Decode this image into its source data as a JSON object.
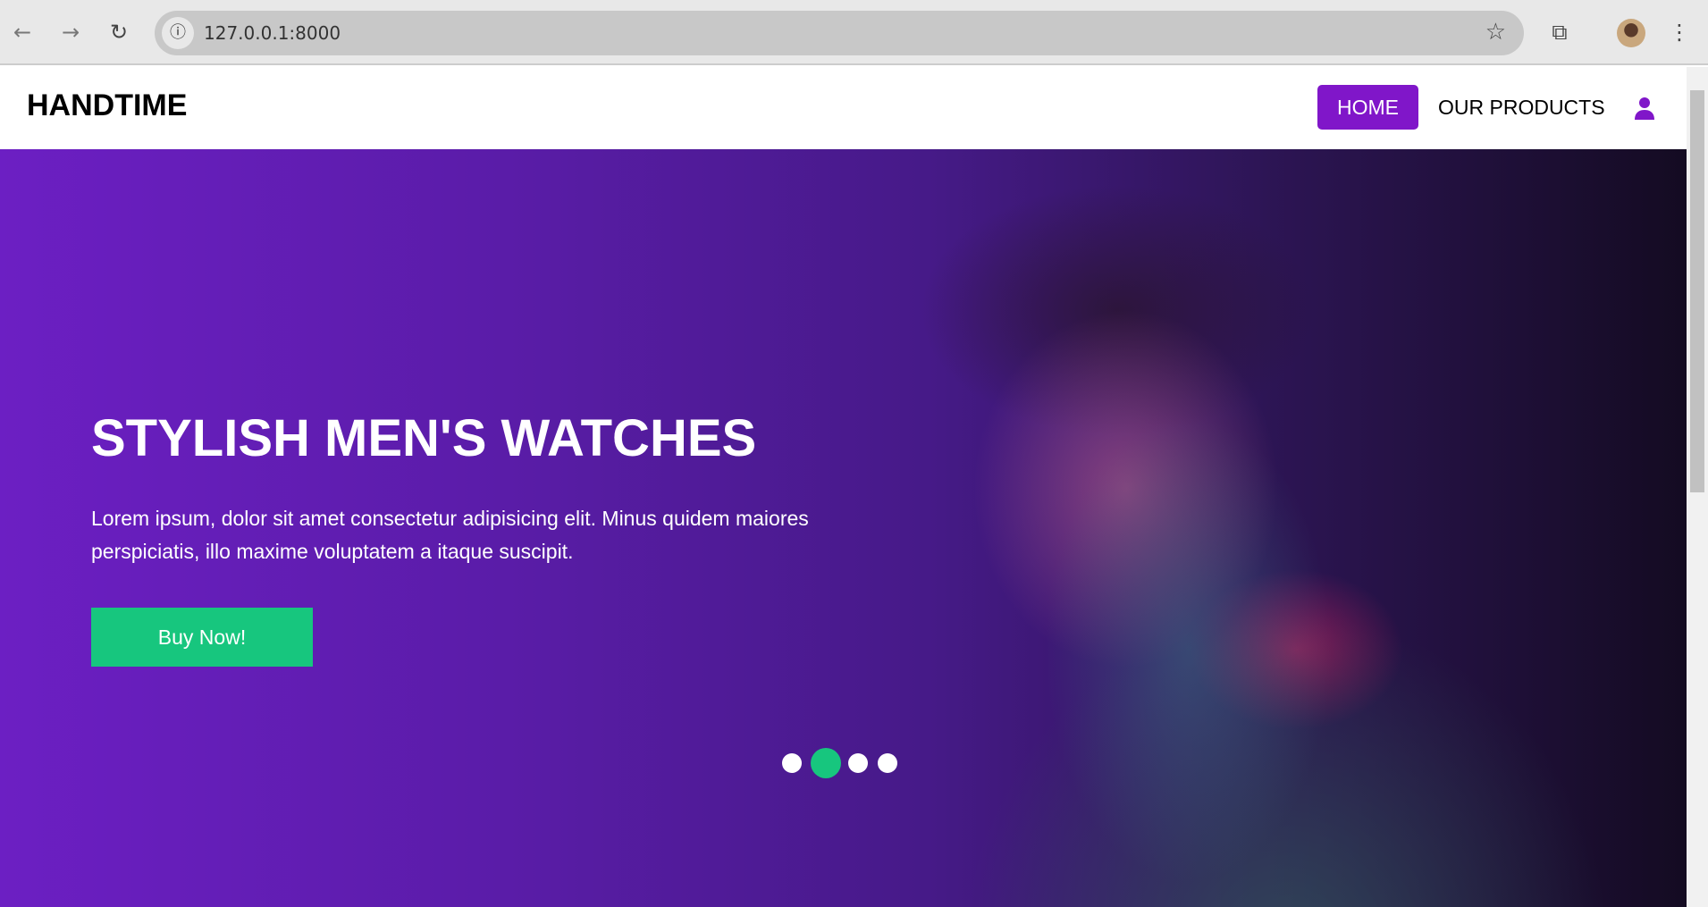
{
  "browser": {
    "url": "127.0.0.1:8000",
    "back_icon": "arrow-left-icon",
    "forward_icon": "arrow-right-icon",
    "reload_icon": "reload-icon"
  },
  "nav": {
    "logo": "HANDTIME",
    "items": [
      {
        "label": "HOME",
        "active": true
      },
      {
        "label": "OUR PRODUCTS",
        "active": false
      }
    ],
    "user_icon": "user-icon",
    "accent": "#8016c9"
  },
  "hero": {
    "title": "STYLISH MEN'S WATCHES",
    "description": "Lorem ipsum, dolor sit amet consectetur adipisicing elit. Minus quidem maiores perspiciatis, illo maxime voluptatem a itaque suscipit.",
    "button": "Buy Now!",
    "button_color": "#17c67e",
    "slides": 4,
    "active_slide": 2
  }
}
